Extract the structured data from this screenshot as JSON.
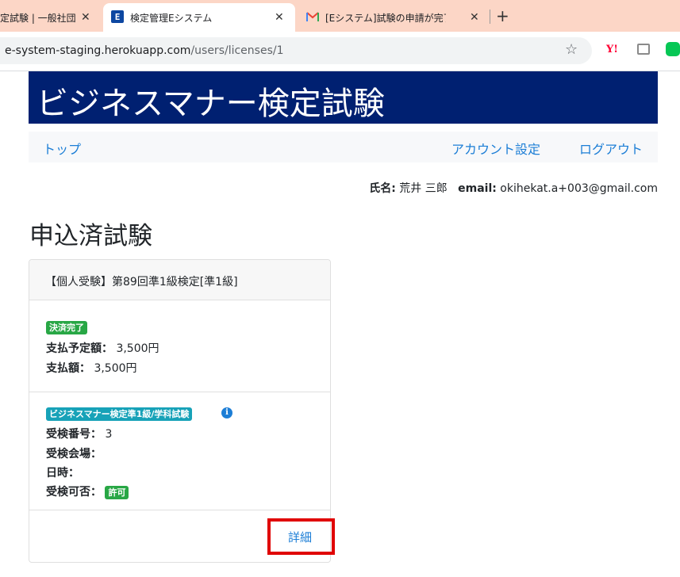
{
  "browser": {
    "tabs": [
      {
        "title": "定試験 | 一般社団",
        "close": "✕"
      },
      {
        "title": "検定管理Eシステム",
        "favicon": "E",
        "close": "✕"
      },
      {
        "title": "[Eシステム]試験の申請が完了しまし",
        "close": "✕"
      }
    ],
    "new_tab": "+",
    "url_host": "e-system-staging.herokuapp.com",
    "url_path": "/users/licenses/1",
    "star": "☆",
    "ext_yahoo": "Y!"
  },
  "site": {
    "title": "ビジネスマナー検定試験",
    "nav": {
      "top": "トップ",
      "account": "アカウント設定",
      "logout": "ログアウト"
    },
    "user": {
      "name_label": "氏名:",
      "name": "荒井 三郎",
      "email_label": "email:",
      "email": "okihekat.a+003@gmail.com"
    }
  },
  "page": {
    "heading": "申込済試験",
    "card": {
      "header": "【個人受験】第89回準1級検定[準1級]",
      "payment_badge": "決済完了",
      "planned_label": "支払予定額：",
      "planned_value": "3,500円",
      "paid_label": "支払額：",
      "paid_value": "3,500円",
      "exam_badge": "ビジネスマナー検定準1級/学科試験",
      "info_icon": "i",
      "number_label": "受検番号：",
      "number_value": "3",
      "venue_label": "受検会場：",
      "venue_value": "",
      "datetime_label": "日時：",
      "datetime_value": "",
      "approval_label": "受検可否：",
      "approval_badge": "許可",
      "detail_link": "詳細"
    }
  },
  "colors": {
    "banner": "#002071",
    "link": "#1c7ed6",
    "badge_green": "#28a745",
    "badge_teal": "#17a2b8",
    "highlight": "#e00000"
  }
}
